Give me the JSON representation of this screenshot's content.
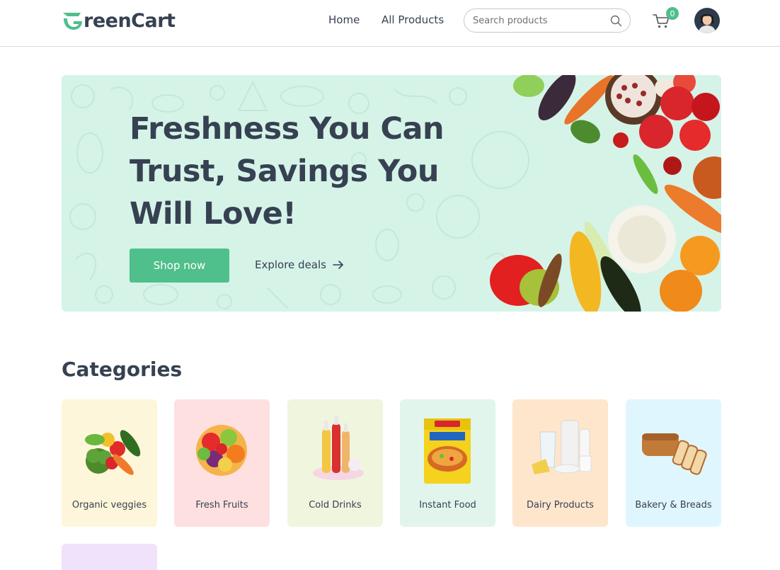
{
  "brand": {
    "name_rest": "reenCart",
    "accent": "#4fbf8b"
  },
  "nav": {
    "home": "Home",
    "all_products": "All Products"
  },
  "search": {
    "placeholder": "Search products"
  },
  "cart": {
    "count": "0"
  },
  "hero": {
    "title": "Freshness You Can Trust, Savings You Will Love!",
    "primary_cta": "Shop now",
    "secondary_cta": "Explore deals",
    "background": "#d6f3e8"
  },
  "categories": {
    "title": "Categories",
    "items": [
      {
        "label": "Organic veggies",
        "color": "#fef6da"
      },
      {
        "label": "Fresh Fruits",
        "color": "#fee0e0"
      },
      {
        "label": "Cold Drinks",
        "color": "#f0f5de"
      },
      {
        "label": "Instant Food",
        "color": "#e1f5ec"
      },
      {
        "label": "Dairy Products",
        "color": "#fee6cd"
      },
      {
        "label": "Bakery & Breads",
        "color": "#e0f6fe"
      },
      {
        "label": "",
        "color": "#f0e2fb"
      }
    ]
  }
}
